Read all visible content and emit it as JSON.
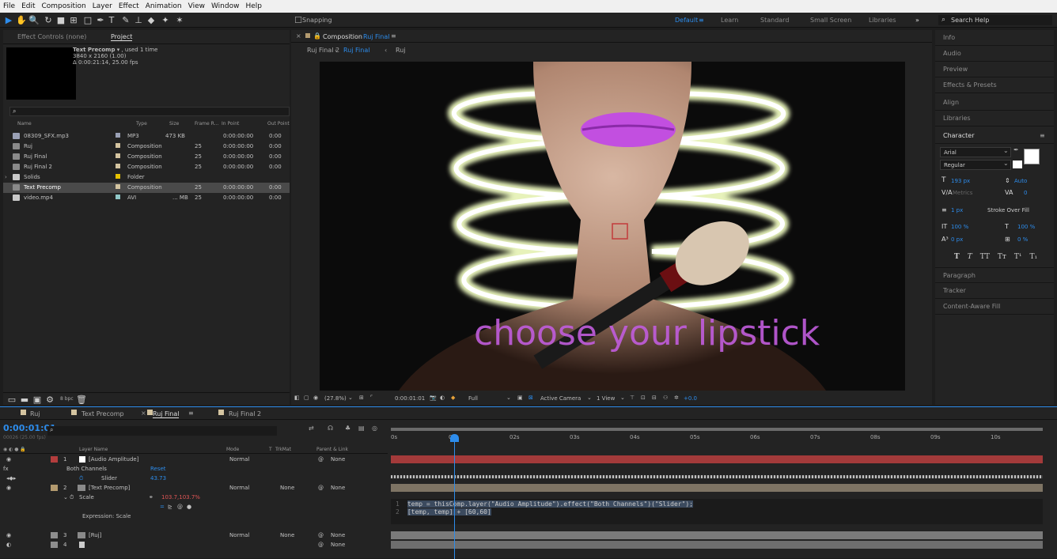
{
  "menu": [
    "File",
    "Edit",
    "Composition",
    "Layer",
    "Effect",
    "Animation",
    "View",
    "Window",
    "Help"
  ],
  "toolbar": {
    "snapping": "Snapping",
    "search_placeholder": "Search Help"
  },
  "workspaces": [
    "Default",
    "Learn",
    "Standard",
    "Small Screen",
    "Libraries"
  ],
  "project": {
    "tabs": [
      "Effect Controls (none)",
      "Project"
    ],
    "selected_name": "Text Precomp",
    "used": ", used 1 time",
    "res": "3840 x 2160 (1.00)",
    "dur": "Δ 0:00:21:14, 25.00 fps",
    "columns": [
      "Name",
      "Type",
      "Size",
      "Frame R...",
      "In Point",
      "Out Point"
    ],
    "items": [
      {
        "name": "08309_SFX.mp3",
        "type": "MP3",
        "size": "473 KB",
        "fr": "",
        "in": "0:00:00:00",
        "out": "0:00",
        "color": "#9aa0b5",
        "icon": "audio-file-icon"
      },
      {
        "name": "Ruj",
        "type": "Composition",
        "size": "",
        "fr": "25",
        "in": "0:00:00:00",
        "out": "0:00",
        "color": "#d4c4a0",
        "icon": "composition-icon"
      },
      {
        "name": "Ruj Final",
        "type": "Composition",
        "size": "",
        "fr": "25",
        "in": "0:00:00:00",
        "out": "0:00",
        "color": "#d4c4a0",
        "icon": "composition-icon"
      },
      {
        "name": "Ruj Final 2",
        "type": "Composition",
        "size": "",
        "fr": "25",
        "in": "0:00:00:00",
        "out": "0:00",
        "color": "#d4c4a0",
        "icon": "composition-icon"
      },
      {
        "name": "Solids",
        "type": "Folder",
        "size": "",
        "fr": "",
        "in": "",
        "out": "",
        "color": "#e6c200",
        "icon": "folder-icon"
      },
      {
        "name": "Text Precomp",
        "type": "Composition",
        "size": "",
        "fr": "25",
        "in": "0:00:00:00",
        "out": "0:00",
        "color": "#d4c4a0",
        "icon": "composition-icon"
      },
      {
        "name": "video.mp4",
        "type": "AVI",
        "size": "... MB",
        "fr": "25",
        "in": "0:00:00:00",
        "out": "0:00",
        "color": "#8fc7c7",
        "icon": "video-file-icon"
      }
    ],
    "bpc": "8 bpc"
  },
  "viewer": {
    "tab": "Composition",
    "tab_comp": "Ruj Final",
    "crumbs": [
      "Ruj Final 2",
      "Ruj Final",
      "Ruj"
    ],
    "overlay_text": "choose your lipstick",
    "zoom": "(27.8%)",
    "time": "0:00:01:01",
    "quality": "Full",
    "camera": "Active Camera",
    "views": "1 View",
    "exposure": "+0.0"
  },
  "right": {
    "panels": [
      "Info",
      "Audio",
      "Preview",
      "Effects & Presets",
      "Align",
      "Libraries"
    ],
    "character": "Character",
    "font": "Arial",
    "style": "Regular",
    "size": "193 px",
    "leading": "Auto",
    "kerning": "Metrics",
    "tracking": "0",
    "stroke_w": "1 px",
    "stroke_type": "Stroke Over Fill",
    "vscale": "100 %",
    "hscale": "100 %",
    "baseline": "0 px",
    "tsume": "0 %",
    "type_styles": [
      "T",
      "T",
      "TT",
      "Tт",
      "T¹",
      "T₁"
    ],
    "after": [
      "Paragraph",
      "Tracker",
      "Content-Aware Fill"
    ]
  },
  "timeline": {
    "tabs": [
      "Ruj",
      "Text Precomp",
      "Ruj Final",
      "Ruj Final 2"
    ],
    "timecode": "0:00:01:01",
    "frames": "00026 (25.00 fps)",
    "headers": [
      "Layer Name",
      "Mode",
      "T",
      "TrkMat",
      "Parent & Link"
    ],
    "ruler": [
      "0s",
      "01s",
      "02s",
      "03s",
      "04s",
      "05s",
      "06s",
      "07s",
      "08s",
      "09s",
      "10s"
    ],
    "layers": [
      {
        "num": "1",
        "name": "[Audio Amplitude]",
        "mode": "Normal",
        "trk": "",
        "parent": "None",
        "color": "#b33d3d"
      },
      {
        "num": "2",
        "name": "[Text Precomp]",
        "mode": "Normal",
        "trk": "None",
        "parent": "None",
        "color": "#b39a6f"
      },
      {
        "num": "3",
        "name": "[Ruj]",
        "mode": "Normal",
        "trk": "None",
        "parent": "None",
        "color": "#8e8e8e"
      },
      {
        "num": "4",
        "name": "",
        "mode": "",
        "trk": "",
        "parent": "None",
        "color": "#8e8e8e"
      }
    ],
    "both_channels": "Both Channels",
    "reset": "Reset",
    "slider": "Slider",
    "slider_val": "43.73",
    "scale": "Scale",
    "scale_val": "103.7,103.7%",
    "expr_label": "Expression: Scale",
    "code": [
      "temp = thisComp.layer(\"Audio Amplitude\").effect(\"Both Channels\")(\"Slider\");",
      "[temp, temp] + [60,60]"
    ],
    "line_nums": [
      "1",
      "2"
    ]
  }
}
